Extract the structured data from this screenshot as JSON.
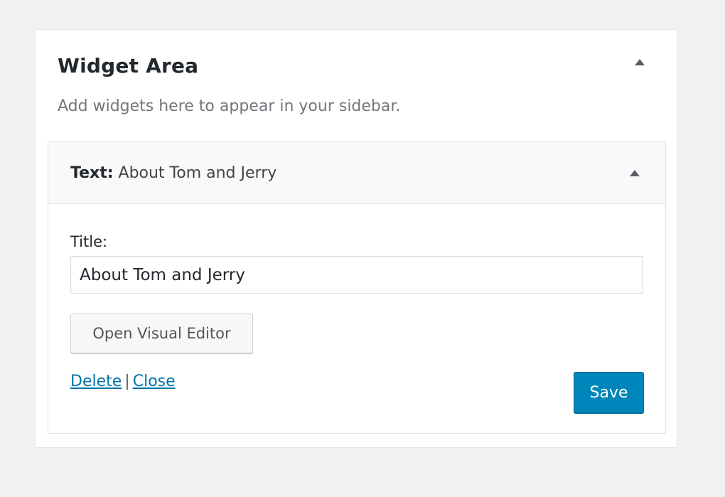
{
  "widget_area": {
    "title": "Widget Area",
    "description": "Add widgets here to appear in your sidebar.",
    "toggle_icon": "arrow-up-icon"
  },
  "widget": {
    "type_label": "Text:",
    "name": "About Tom and Jerry",
    "toggle_icon": "arrow-up-icon",
    "form": {
      "title_label": "Title:",
      "title_value": "About Tom and Jerry",
      "visual_editor_label": "Open Visual Editor"
    },
    "actions": {
      "delete_label": "Delete",
      "separator": "|",
      "close_label": "Close",
      "save_label": "Save"
    }
  },
  "colors": {
    "background": "#f1f1f1",
    "link": "#0073aa",
    "primary_button": "#0085ba"
  }
}
